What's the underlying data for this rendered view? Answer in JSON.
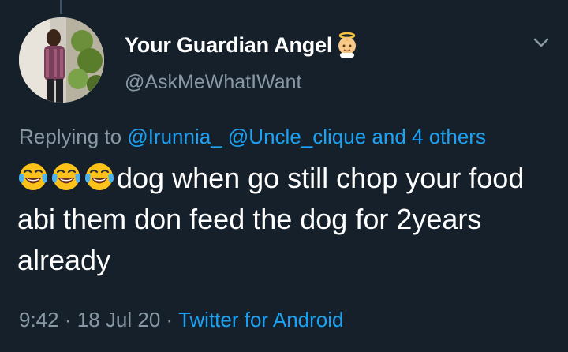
{
  "tweet": {
    "display_name": "Your Guardian Angel",
    "handle": "@AskMeWhatIWant",
    "reply_prefix": "Replying to ",
    "reply_mention_1": "@Irunnia_",
    "reply_mention_2": "@Uncle_clique",
    "reply_others": "and 4 others",
    "body_text": "dog when go still chop your food abi them don feed the dog for 2years already",
    "emoji_name": "face-with-tears-of-joy-icon",
    "emoji_count": 3,
    "time": "9:42",
    "separator": "·",
    "date": "18 Jul 20",
    "source": "Twitter for Android"
  },
  "colors": {
    "background": "#15202b",
    "text": "#ffffff",
    "secondary": "#8899a6",
    "link": "#1da1f2"
  },
  "icons": {
    "name_badge": "baby-angel-icon",
    "menu": "chevron-down-icon",
    "avatar": "profile-avatar"
  }
}
